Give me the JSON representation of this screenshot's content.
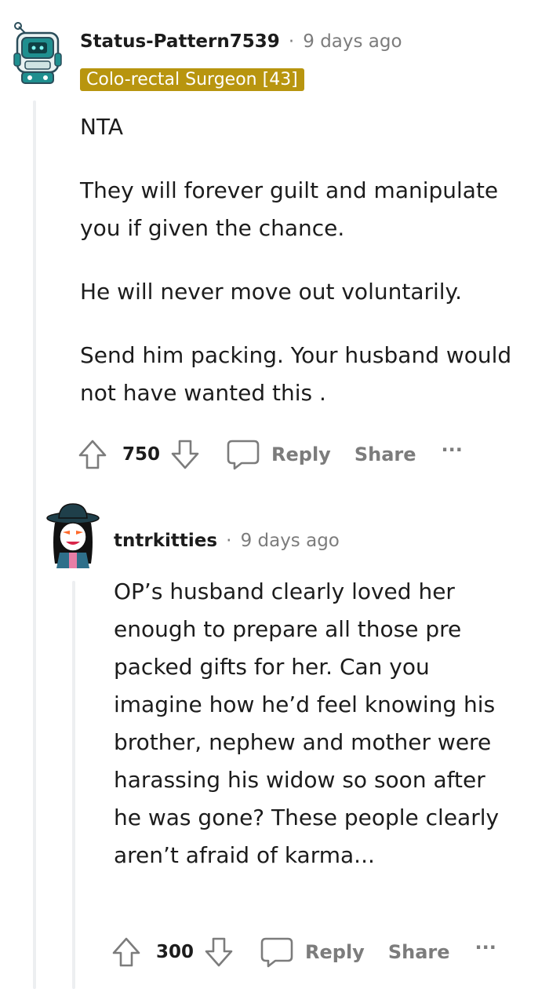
{
  "comments": [
    {
      "username": "Status-Pattern7539",
      "separator": "·",
      "time": "9 days ago",
      "flair": "Colo-rectal Surgeon [43]",
      "paragraphs": [
        "NTA",
        "They will forever guilt and manipulate you if given the chance.",
        "He will never move out voluntarily.",
        "Send him packing. Your husband would not have wanted this ."
      ],
      "votes": "750",
      "reply_label": "Reply",
      "share_label": "Share",
      "more_label": "···",
      "avatar_icon": "robot-avatar-icon"
    },
    {
      "username": "tntrkitties",
      "separator": "·",
      "time": "9 days ago",
      "paragraphs": [
        "OP’s husband clearly loved her enough to prepare all those pre packed gifts for her. Can you imagine how he’d feel knowing his brother, nephew and mother were harassing his widow so soon after he was gone? These people clearly aren’t afraid of karma..."
      ],
      "votes": "300",
      "reply_label": "Reply",
      "share_label": "Share",
      "more_label": "···",
      "avatar_icon": "hat-girl-avatar-icon"
    }
  ],
  "colors": {
    "flair_bg": "#b8950f",
    "muted": "#7c7c7c",
    "thread_line": "#edeff1"
  }
}
